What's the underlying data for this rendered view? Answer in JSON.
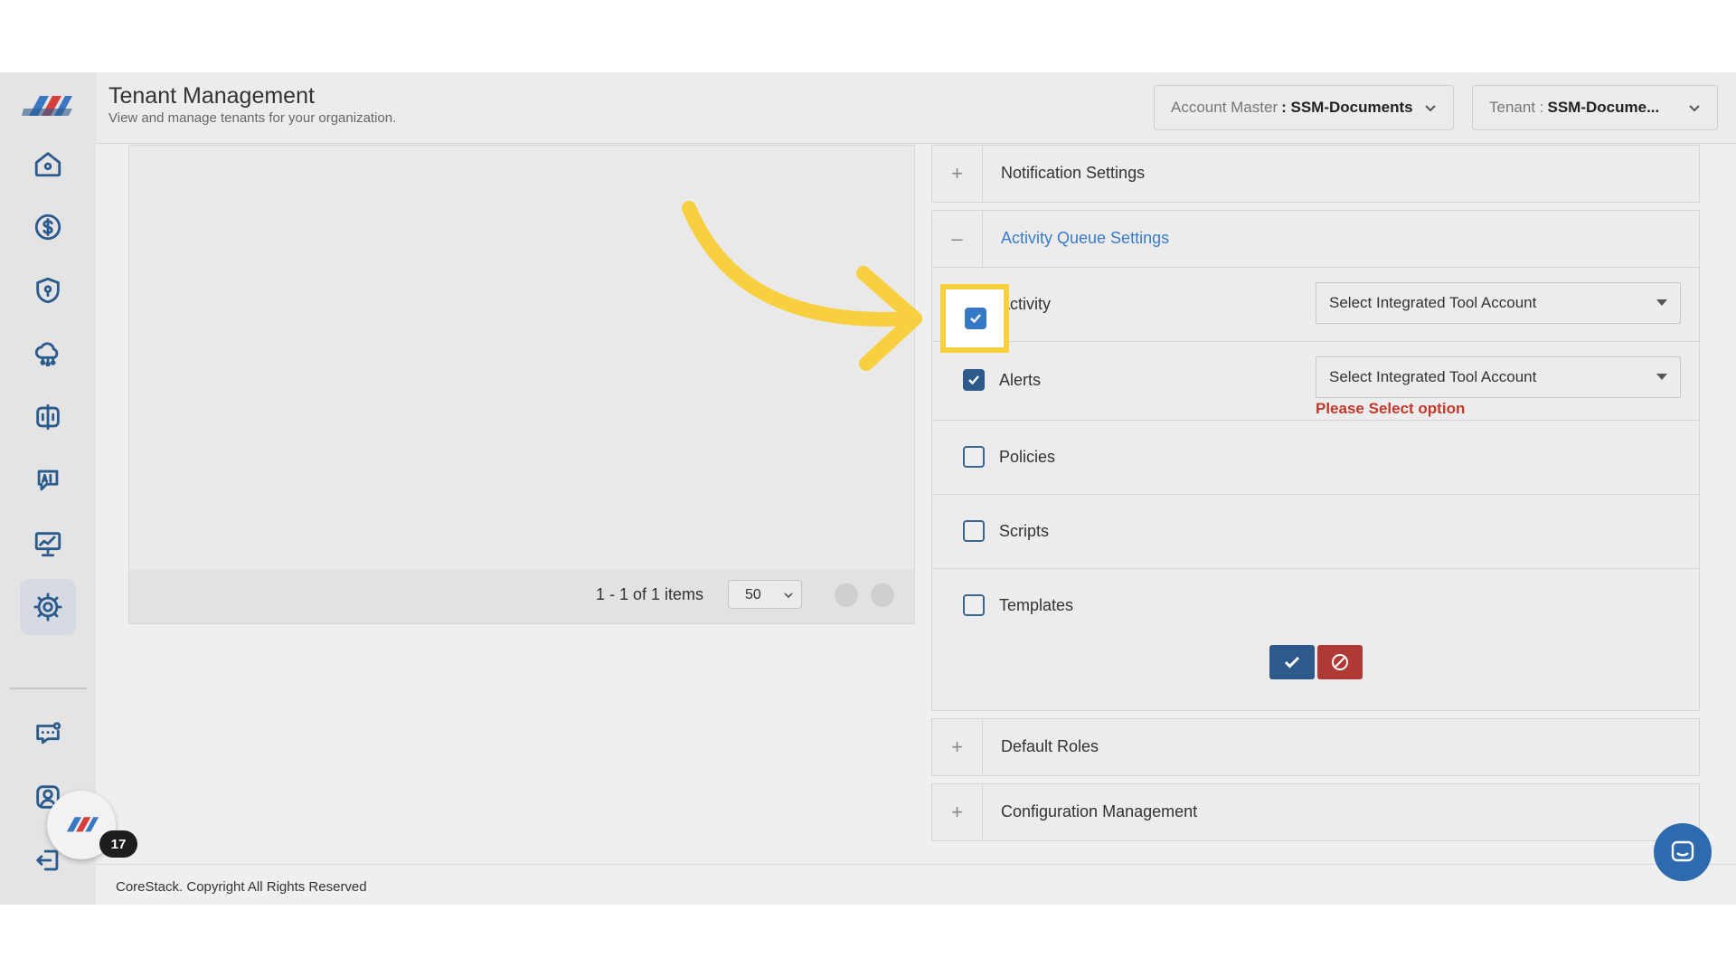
{
  "header": {
    "title": "Tenant Management",
    "subtitle": "View and manage tenants for your organization.",
    "account_master_label": "Account Master",
    "account_master_value": ": SSM-Documents",
    "tenant_label": "Tenant : ",
    "tenant_value": "SSM-Docume..."
  },
  "sidebar": {
    "items": [
      {
        "icon": "home-icon"
      },
      {
        "icon": "dollar-icon"
      },
      {
        "icon": "shield-icon"
      },
      {
        "icon": "cloud-network-icon"
      },
      {
        "icon": "split-panel-icon"
      },
      {
        "icon": "ai-chat-icon"
      },
      {
        "icon": "presentation-chart-icon"
      },
      {
        "icon": "gear-icon",
        "active": true
      },
      {
        "icon": "chat-bubble-icon"
      },
      {
        "icon": "user-profile-icon"
      },
      {
        "icon": "logout-icon"
      }
    ],
    "badge_count": "17"
  },
  "grid": {
    "pager_text": "1 - 1 of 1 items",
    "page_size": "50"
  },
  "settings": {
    "notification_title": "Notification Settings",
    "activity_queue_title": "Activity Queue Settings",
    "rows": [
      {
        "label": "Activity",
        "checked": true,
        "dropdown": "Select Integrated Tool Account"
      },
      {
        "label": "Alerts",
        "checked": true,
        "dropdown": "Select Integrated Tool Account",
        "error": "Please Select option"
      },
      {
        "label": "Policies",
        "checked": false
      },
      {
        "label": "Scripts",
        "checked": false
      },
      {
        "label": "Templates",
        "checked": false
      }
    ],
    "default_roles_title": "Default Roles",
    "config_mgmt_title": "Configuration Management",
    "toggle_plus": "+",
    "toggle_minus": "–"
  },
  "footer": {
    "text": "CoreStack. Copyright All Rights Reserved"
  },
  "colors": {
    "accent": "#2d5a8b",
    "highlight": "#f8d03f",
    "error": "#c0392b",
    "cancel": "#b23a36"
  }
}
